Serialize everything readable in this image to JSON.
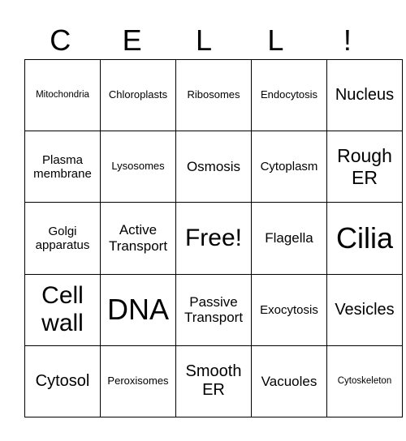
{
  "header": [
    "C",
    "E",
    "L",
    "L",
    "!"
  ],
  "rows": [
    [
      "Mitochondria",
      "Chloroplasts",
      "Ribosomes",
      "Endocytosis",
      "Nucleus"
    ],
    [
      "Plasma membrane",
      "Lysosomes",
      "Osmosis",
      "Cytoplasm",
      "Rough ER"
    ],
    [
      "Golgi apparatus",
      "Active Transport",
      "Free!",
      "Flagella",
      "Cilia"
    ],
    [
      "Cell wall",
      "DNA",
      "Passive Transport",
      "Exocytosis",
      "Vesicles"
    ],
    [
      "Cytosol",
      "Peroxisomes",
      "Smooth ER",
      "Vacuoles",
      "Cytoskeleton"
    ]
  ]
}
